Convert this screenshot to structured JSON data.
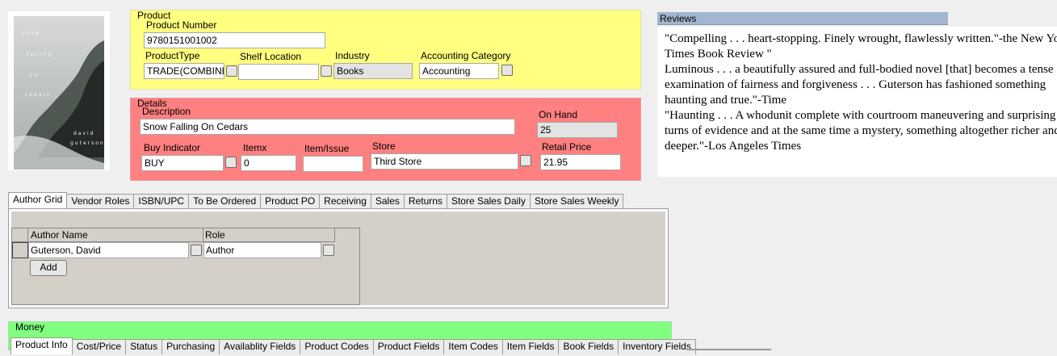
{
  "cover": {
    "title_lines": [
      "snow",
      "falling",
      "on",
      "cedars"
    ],
    "author_lines": [
      "david",
      "guterson"
    ]
  },
  "product": {
    "group_title": "Product",
    "product_number_label": "Product Number",
    "product_number": "9780151001002",
    "product_type_label": "ProductType",
    "product_type": "TRADE(COMBINED",
    "shelf_location_label": "Shelf Location",
    "shelf_location": "",
    "industry_label": "Industry",
    "industry": "Books",
    "accounting_category_label": "Accounting Category",
    "accounting_category": "Accounting"
  },
  "details": {
    "group_title": "Details",
    "description_label": "Description",
    "description": "Snow Falling On Cedars",
    "on_hand_label": "On Hand",
    "on_hand": "25",
    "buy_indicator_label": "Buy Indicator",
    "buy_indicator": "BUY",
    "itemx_label": "Itemx",
    "itemx": "0",
    "item_issue_label": "Item/Issue",
    "item_issue": "",
    "store_label": "Store",
    "store": "Third Store",
    "retail_price_label": "Retail Price",
    "retail_price": "21.95"
  },
  "reviews": {
    "title": "Reviews",
    "lines": [
      "\"Compelling . . . heart-stopping. Finely wrought, flawlessly written.\"-the New York",
      "Times Book Review \"",
      "Luminous . . . a beautifully assured and full-bodied novel [that] becomes a tense",
      "examination of fairness and forgiveness . . . Guterson has fashioned something",
      "haunting and true.\"-Time",
      "\"Haunting . . . A whodunit complete with courtroom maneuvering and surprising",
      "turns of evidence and at the same time a mystery, something altogether richer and",
      "deeper.\"-Los Angeles Times"
    ]
  },
  "tabs_top": [
    {
      "label": "Author Grid",
      "selected": true
    },
    {
      "label": "Vendor Roles"
    },
    {
      "label": "ISBN/UPC"
    },
    {
      "label": "To Be Ordered"
    },
    {
      "label": "Product PO"
    },
    {
      "label": "Receiving"
    },
    {
      "label": "Sales"
    },
    {
      "label": "Returns"
    },
    {
      "label": "Store Sales Daily"
    },
    {
      "label": "Store Sales Weekly"
    }
  ],
  "author_grid": {
    "columns": [
      "Author Name",
      "Role"
    ],
    "rows": [
      {
        "author_name": "Guterson, David",
        "role": "Author"
      }
    ],
    "add_button": "Add"
  },
  "money": {
    "group_title": "Money",
    "tabs": [
      {
        "label": "Product Info",
        "selected": true
      },
      {
        "label": "Cost/Price"
      },
      {
        "label": "Status"
      },
      {
        "label": "Purchasing"
      },
      {
        "label": "Availablity Fields"
      },
      {
        "label": "Product Codes"
      },
      {
        "label": "Product Fields"
      },
      {
        "label": "Item Codes"
      },
      {
        "label": "Item Fields"
      },
      {
        "label": "Book Fields"
      },
      {
        "label": "Inventory Fields"
      }
    ]
  },
  "colors": {
    "product_group": "#ffff80",
    "details_group": "#ff8080",
    "money_group": "#80ff80",
    "reviews_header": "#a3b6cf"
  }
}
